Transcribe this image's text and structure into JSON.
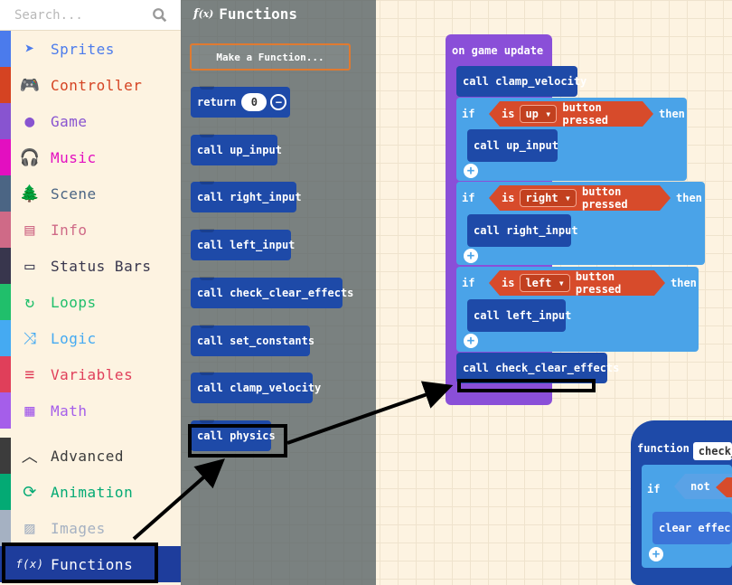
{
  "search": {
    "placeholder": "Search..."
  },
  "categories": [
    {
      "label": "Sprites",
      "icon": "sprites-icon",
      "color": "#4b7bec"
    },
    {
      "label": "Controller",
      "icon": "controller-icon",
      "color": "#d54322"
    },
    {
      "label": "Game",
      "icon": "game-icon",
      "color": "#8854d0"
    },
    {
      "label": "Music",
      "icon": "music-icon",
      "color": "#e30fc0"
    },
    {
      "label": "Scene",
      "icon": "scene-icon",
      "color": "#4b6584"
    },
    {
      "label": "Info",
      "icon": "info-icon",
      "color": "#cf6a87"
    },
    {
      "label": "Status Bars",
      "icon": "status-bars-icon",
      "color": "#38364d"
    },
    {
      "label": "Loops",
      "icon": "loops-icon",
      "color": "#20bf6b"
    },
    {
      "label": "Logic",
      "icon": "logic-icon",
      "color": "#45aaf2"
    },
    {
      "label": "Variables",
      "icon": "variables-icon",
      "color": "#e03f5a"
    },
    {
      "label": "Math",
      "icon": "math-icon",
      "color": "#a55eea"
    }
  ],
  "advanced_categories": [
    {
      "label": "Advanced",
      "icon": "chevron-up-icon",
      "color": "#3c3c3c"
    },
    {
      "label": "Animation",
      "icon": "animation-icon",
      "color": "#03aa74"
    },
    {
      "label": "Images",
      "icon": "images-icon",
      "color": "#a5b1c2"
    },
    {
      "label": "Functions",
      "icon": "functions-icon",
      "color": "#1e3d9c"
    }
  ],
  "flyout": {
    "title": "Functions",
    "make_function": "Make a Function...",
    "return_label": "return",
    "return_value": "0",
    "blocks": [
      {
        "call": "call",
        "name": "up_input"
      },
      {
        "call": "call",
        "name": "right_input"
      },
      {
        "call": "call",
        "name": "left_input"
      },
      {
        "call": "call",
        "name": "check_clear_effects"
      },
      {
        "call": "call",
        "name": "set_constants"
      },
      {
        "call": "call",
        "name": "clamp_velocity"
      },
      {
        "call": "call",
        "name": "physics"
      }
    ]
  },
  "program": {
    "event": "on game update",
    "first_call": "call clamp_velocity",
    "ifs": [
      {
        "if": "if",
        "is": "is",
        "button": "up",
        "pressed": "button pressed",
        "then": "then",
        "body": "call up_input"
      },
      {
        "if": "if",
        "is": "is",
        "button": "right",
        "pressed": "button pressed",
        "then": "then",
        "body": "call right_input"
      },
      {
        "if": "if",
        "is": "is",
        "button": "left",
        "pressed": "button pressed",
        "then": "then",
        "body": "call left_input"
      }
    ],
    "last_call": "call check_clear_effects"
  },
  "function_def": {
    "label": "function",
    "name": "check_",
    "if": "if",
    "not": "not",
    "body": "clear effec"
  },
  "colors": {
    "toolbox_bg": "#fdf3e1",
    "event_purple": "#8a4fd8",
    "if_blue": "#4aa3e8",
    "call_blue": "#1e4aa8",
    "hex_red": "#d74b2b",
    "highlight": "#000000"
  }
}
